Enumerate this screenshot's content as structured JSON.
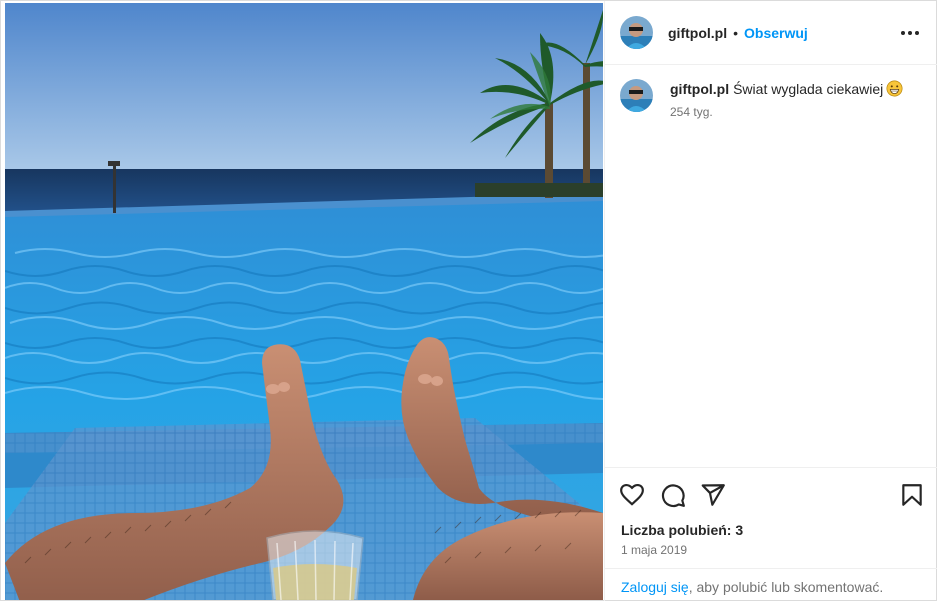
{
  "post": {
    "username": "giftpol.pl",
    "separator": "•",
    "follow_label": "Obserwuj",
    "more_icon": "more-horizontal-icon"
  },
  "caption": {
    "username": "giftpol.pl",
    "text": "Świat wyglada ciekawiej",
    "emoji": "grinning-face-emoji",
    "time": "254 tyg."
  },
  "actions": {
    "icons": [
      "heart-icon",
      "comment-icon",
      "share-icon",
      "bookmark-icon"
    ]
  },
  "stats": {
    "likes": "Liczba polubień: 3",
    "date": "1 maja 2019"
  },
  "login": {
    "link": "Zaloguj się",
    "rest": ", aby polubić lub skomentować."
  },
  "colors": {
    "link": "#0095f6",
    "pool": "#1f9fe0",
    "sky": "#6aa0d8",
    "sea": "#1d4a7a"
  }
}
